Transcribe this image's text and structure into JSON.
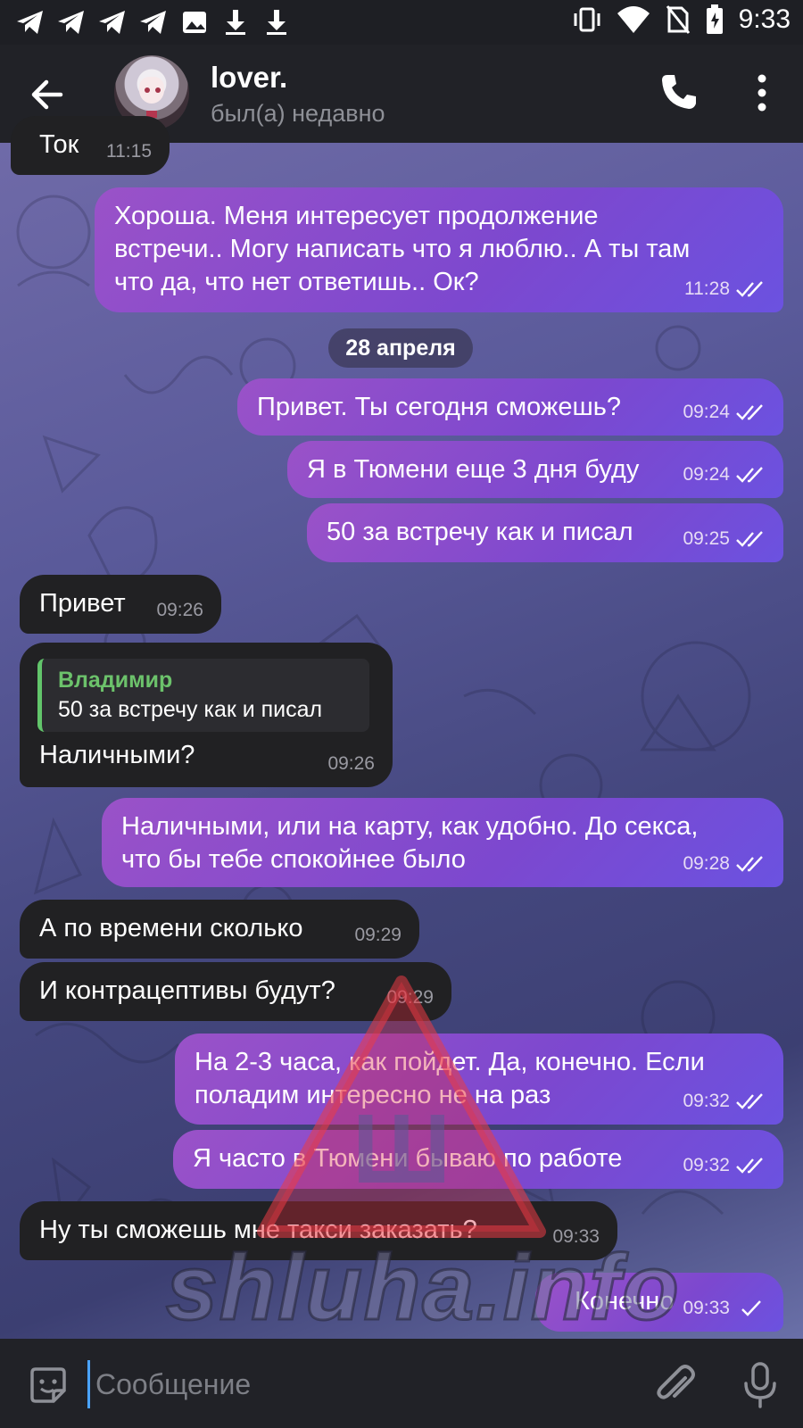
{
  "status_bar": {
    "time": "9:33",
    "left_icons": [
      "telegram-icon",
      "telegram-icon",
      "telegram-icon",
      "telegram-icon",
      "image-icon",
      "download-icon",
      "download-icon"
    ],
    "right_icons": [
      "vibrate-icon",
      "wifi-icon",
      "no-sim-icon",
      "battery-charging-icon"
    ]
  },
  "header": {
    "contact_name": "lover.",
    "contact_status": "был(а) недавно",
    "icons": [
      "back-arrow-icon",
      "phone-icon",
      "more-vert-icon"
    ]
  },
  "messages": [
    {
      "id": "m0",
      "direction": "in",
      "text": "Ток",
      "time": "11:15"
    },
    {
      "id": "m1",
      "direction": "out",
      "lines": [
        "Хороша. Меня интересует продолжение",
        "встречи.. Могу написать что я люблю.. А ты там",
        "что да, что нет ответишь.. Ок?"
      ],
      "time": "11:28",
      "read": true
    },
    {
      "id": "m2",
      "direction": "out",
      "text": "Привет. Ты сегодня сможешь?",
      "time": "09:24",
      "read": true
    },
    {
      "id": "m3",
      "direction": "out",
      "text": "Я в Тюмени еще 3 дня буду",
      "time": "09:24",
      "read": true
    },
    {
      "id": "m4",
      "direction": "out",
      "text": "50 за встречу как и писал",
      "time": "09:25",
      "read": true
    },
    {
      "id": "m5",
      "direction": "in",
      "text": "Привет",
      "time": "09:26"
    },
    {
      "id": "m6",
      "direction": "in",
      "reply_author": "Владимир",
      "reply_text": "50 за встречу как и писал",
      "text": "Наличными?",
      "time": "09:26"
    },
    {
      "id": "m7",
      "direction": "out",
      "lines": [
        "Наличными, или на карту, как удобно. До секса,",
        "что бы тебе спокойнее было"
      ],
      "time": "09:28",
      "read": true
    },
    {
      "id": "m8",
      "direction": "in",
      "text": "А по времени сколько",
      "time": "09:29"
    },
    {
      "id": "m9",
      "direction": "in",
      "text": "И контрацептивы будут?",
      "time": "09:29"
    },
    {
      "id": "m10",
      "direction": "out",
      "lines": [
        "На 2-3 часа, как пойдет. Да, конечно. Если",
        "поладим интересно не на раз"
      ],
      "time": "09:32",
      "read": true
    },
    {
      "id": "m11",
      "direction": "out",
      "text": "Я часто в Тюмени бываю по работе",
      "time": "09:32",
      "read": true
    },
    {
      "id": "m12",
      "direction": "in",
      "text": "Ну ты сможешь мне такси заказать?",
      "time": "09:33"
    },
    {
      "id": "m13",
      "direction": "out",
      "text": "Конечно",
      "time": "09:33",
      "read": false
    }
  ],
  "date_separator": "28 апреля",
  "watermark": {
    "text": "shluha.info",
    "logo_letter": "Ш"
  },
  "input": {
    "placeholder": "Сообщение",
    "icons": [
      "emoji-sticker-icon",
      "attach-icon",
      "mic-icon"
    ]
  },
  "colors": {
    "outgoing_bubble": "#8a4fd0",
    "incoming_bubble": "#212123",
    "reply_accent": "#62c56b",
    "header_bg": "#212227"
  }
}
